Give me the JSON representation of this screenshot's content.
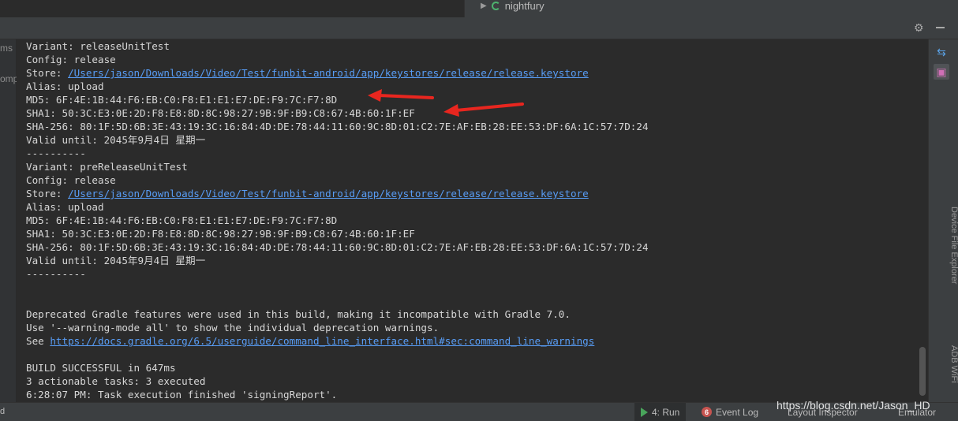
{
  "top": {
    "tree_item": "nightfury"
  },
  "left_gutter": {
    "fragment_top": "ms",
    "fragment_mid": "omp"
  },
  "console": {
    "lines": [
      {
        "text": "Variant: releaseUnitTest"
      },
      {
        "text": "Config: release"
      },
      {
        "prefix": "Store: ",
        "link": "/Users/jason/Downloads/Video/Test/funbit-android/app/keystores/release/release.keystore"
      },
      {
        "text": "Alias: upload"
      },
      {
        "text": "MD5: 6F:4E:1B:44:F6:EB:C0:F8:E1:E1:E7:DE:F9:7C:F7:8D"
      },
      {
        "text": "SHA1: 50:3C:E3:0E:2D:F8:E8:8D:8C:98:27:9B:9F:B9:C8:67:4B:60:1F:EF"
      },
      {
        "text": "SHA-256: 80:1F:5D:6B:3E:43:19:3C:16:84:4D:DE:78:44:11:60:9C:8D:01:C2:7E:AF:EB:28:EE:53:DF:6A:1C:57:7D:24"
      },
      {
        "text": "Valid until: 2045年9月4日 星期一"
      },
      {
        "text": "----------"
      },
      {
        "text": "Variant: preReleaseUnitTest"
      },
      {
        "text": "Config: release"
      },
      {
        "prefix": "Store: ",
        "link": "/Users/jason/Downloads/Video/Test/funbit-android/app/keystores/release/release.keystore"
      },
      {
        "text": "Alias: upload"
      },
      {
        "text": "MD5: 6F:4E:1B:44:F6:EB:C0:F8:E1:E1:E7:DE:F9:7C:F7:8D"
      },
      {
        "text": "SHA1: 50:3C:E3:0E:2D:F8:E8:8D:8C:98:27:9B:9F:B9:C8:67:4B:60:1F:EF"
      },
      {
        "text": "SHA-256: 80:1F:5D:6B:3E:43:19:3C:16:84:4D:DE:78:44:11:60:9C:8D:01:C2:7E:AF:EB:28:EE:53:DF:6A:1C:57:7D:24"
      },
      {
        "text": "Valid until: 2045年9月4日 星期一"
      },
      {
        "text": "----------"
      },
      {
        "text": ""
      },
      {
        "text": ""
      },
      {
        "text": "Deprecated Gradle features were used in this build, making it incompatible with Gradle 7.0."
      },
      {
        "text": "Use '--warning-mode all' to show the individual deprecation warnings."
      },
      {
        "prefix": "See ",
        "link": "https://docs.gradle.org/6.5/userguide/command_line_interface.html#sec:command_line_warnings"
      },
      {
        "text": ""
      },
      {
        "text": "BUILD SUCCESSFUL in 647ms"
      },
      {
        "text": "3 actionable tasks: 3 executed"
      },
      {
        "text": "6:28:07 PM: Task execution finished 'signingReport'."
      }
    ]
  },
  "right_rail": {
    "vertical_label_1": "Device File Explorer",
    "vertical_label_2": "ADB WiFi"
  },
  "status_bar": {
    "left_fragment": "d",
    "run_tab": "4: Run",
    "event_log_badge": "6",
    "event_log_tab": "Event Log",
    "layout_inspector_tab": "Layout Inspector",
    "emulator_tab": "Emulator"
  },
  "watermark": "https://blog.csdn.net/Jason_HD",
  "colors": {
    "accent_link": "#589df6",
    "arrow_red": "#e8261f",
    "run_green": "#49a55b"
  }
}
